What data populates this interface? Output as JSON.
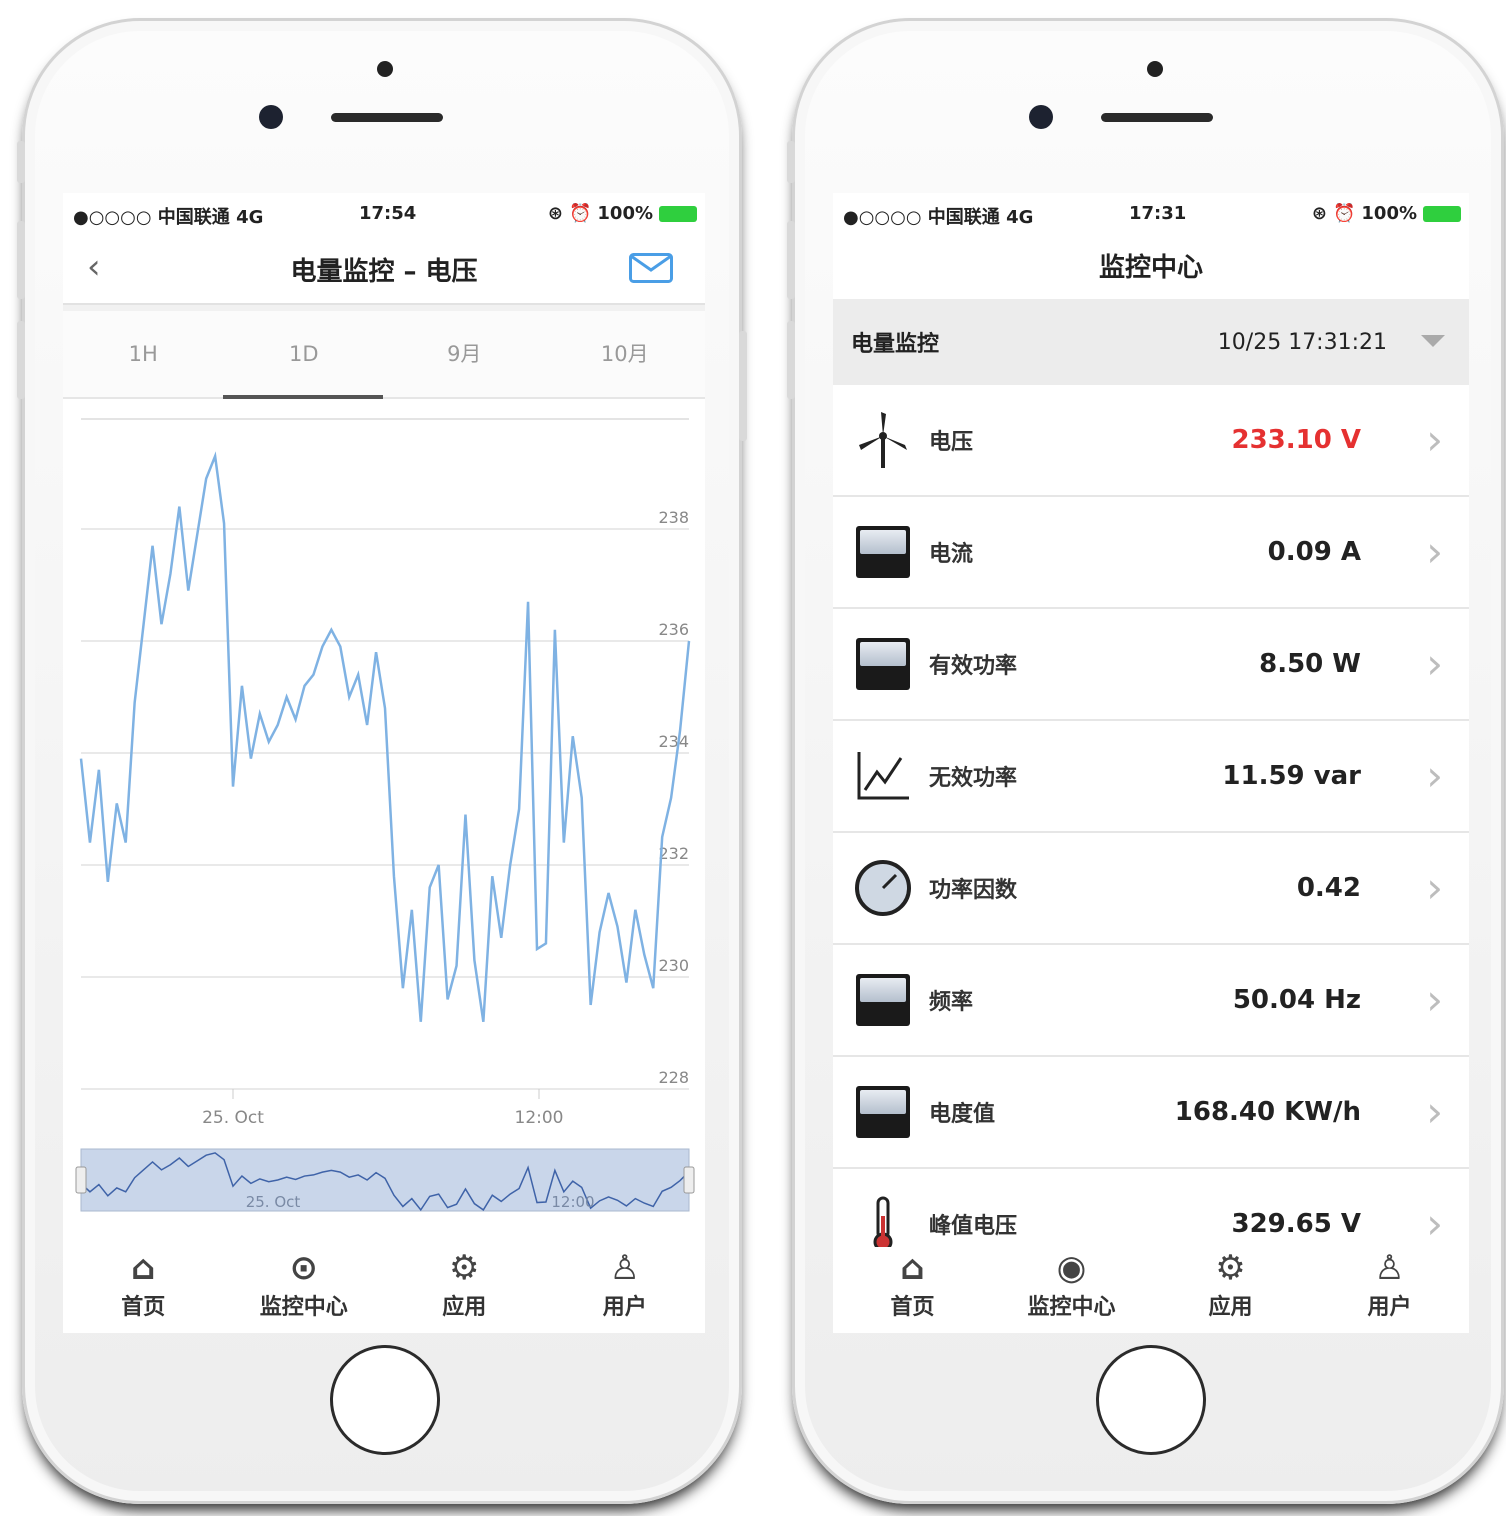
{
  "left_phone": {
    "status": {
      "carrier": "●○○○○ 中国联通  4G",
      "time": "17:54",
      "battery": "100%"
    },
    "nav": {
      "title": "电量监控 – 电压"
    },
    "tabs": [
      "1H",
      "1D",
      "9月",
      "10月"
    ],
    "bottom_nav": [
      "首页",
      "监控中心",
      "应用",
      "用户"
    ],
    "navigator_labels": [
      "25. Oct",
      "12:00"
    ]
  },
  "right_phone": {
    "status": {
      "carrier": "●○○○○ 中国联通  4G",
      "time": "17:31",
      "battery": "100%"
    },
    "nav": {
      "title": "监控中心"
    },
    "section": {
      "title": "电量监控",
      "timestamp": "10/25 17:31:21"
    },
    "rows": [
      {
        "label": "电压",
        "value": "233.10 V",
        "icon": "wind-turbine-icon"
      },
      {
        "label": "电流",
        "value": "0.09 A",
        "icon": "meter-icon"
      },
      {
        "label": "有效功率",
        "value": "8.50 W",
        "icon": "meter-icon"
      },
      {
        "label": "无效功率",
        "value": "11.59 var",
        "icon": "line-chart-icon"
      },
      {
        "label": "功率因数",
        "value": "0.42",
        "icon": "gauge-icon"
      },
      {
        "label": "频率",
        "value": "50.04 Hz",
        "icon": "meter-icon"
      },
      {
        "label": "电度值",
        "value": "168.40 KW/h",
        "icon": "meter-icon"
      },
      {
        "label": "峰值电压",
        "value": "329.65 V",
        "icon": "thermometer-icon"
      }
    ],
    "bottom_nav": [
      "首页",
      "监控中心",
      "应用",
      "用户"
    ]
  },
  "colors": {
    "line": "#7fb2e3",
    "alert": "#e53131",
    "navigator_fill": "#c9d6ea"
  },
  "chart_data": {
    "type": "line",
    "title": "",
    "xlabel": "",
    "ylabel": "",
    "ylim": [
      228,
      238
    ],
    "yticks": [
      238,
      236,
      234,
      232,
      230,
      228
    ],
    "xticks": [
      "25. Oct",
      "12:00"
    ],
    "grid": true,
    "series": [
      {
        "values": [
          233.9,
          232.4,
          233.7,
          231.7,
          233.1,
          232.4,
          234.9,
          236.3,
          237.7,
          236.3,
          237.2,
          238.4,
          236.9,
          237.9,
          238.9,
          239.3,
          238.1,
          233.4,
          235.2,
          233.9,
          234.7,
          234.2,
          234.5,
          235.0,
          234.6,
          235.2,
          235.4,
          235.9,
          236.2,
          235.9,
          235.0,
          235.4,
          234.5,
          235.8,
          234.8,
          231.8,
          229.8,
          231.2,
          229.2,
          231.6,
          232.0,
          229.6,
          230.2,
          232.9,
          230.3,
          229.2,
          231.8,
          230.7,
          232.0,
          233.0,
          236.7,
          230.5,
          230.6,
          236.2,
          232.4,
          234.3,
          233.2,
          229.5,
          230.8,
          231.5,
          230.9,
          229.9,
          231.2,
          230.4,
          229.8,
          232.5,
          233.2,
          234.4,
          236.0
        ]
      }
    ]
  }
}
